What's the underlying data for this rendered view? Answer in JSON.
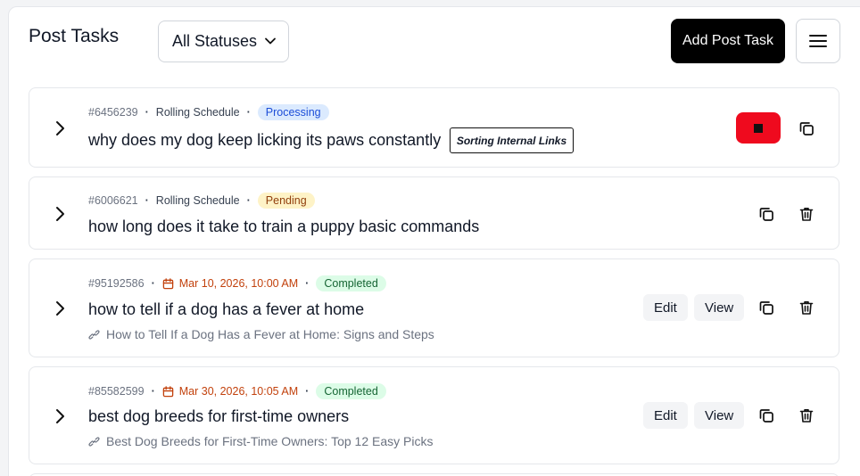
{
  "header": {
    "title": "Post Tasks",
    "status_filter": "All Statuses",
    "add_button": "Add Post Task"
  },
  "tasks": [
    {
      "id": "#6456239",
      "schedule": "Rolling Schedule",
      "status": "Processing",
      "title": "why does my dog keep licking its paws constantly",
      "tooltip": "Sorting Internal Links"
    },
    {
      "id": "#6006621",
      "schedule": "Rolling Schedule",
      "status": "Pending",
      "title": "how long does it take to train a puppy basic commands"
    },
    {
      "id": "#95192586",
      "schedule": "Mar 10, 2026, 10:00 AM",
      "status": "Completed",
      "title": "how to tell if a dog has a fever at home",
      "link": "How to Tell If a Dog Has a Fever at Home: Signs and Steps",
      "edit_label": "Edit",
      "view_label": "View"
    },
    {
      "id": "#85582599",
      "schedule": "Mar 30, 2026, 10:05 AM",
      "status": "Completed",
      "title": "best dog breeds for first-time owners",
      "link": "Best Dog Breeds for First-Time Owners: Top 12 Easy Picks",
      "edit_label": "Edit",
      "view_label": "View"
    }
  ],
  "colors": {
    "processing_bg": "#dbeafe",
    "pending_bg": "#fef3c7",
    "completed_bg": "#dcfce7",
    "stop_button": "#ef0a1e",
    "date_accent": "#c2410c"
  }
}
